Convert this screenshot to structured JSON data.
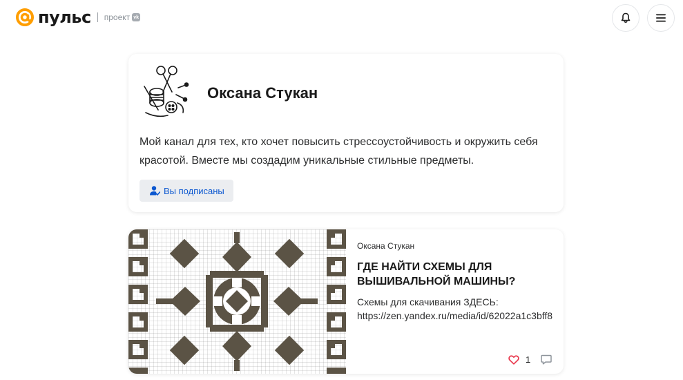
{
  "header": {
    "logo_text": "пульс",
    "project_label": "проект",
    "vk_badge": "vk",
    "brand_color": "#ff9e00",
    "icons": [
      "bell-icon",
      "menu-icon"
    ]
  },
  "channel": {
    "name": "Оксана Стукан",
    "description": "Мой канал для тех, кто хочет повысить стрессоустойчивость и окружить себя красотой. Вместе мы создадим уникальные стильные предметы.",
    "subscribe_label": "Вы подписаны",
    "accent_color": "#0b57d0"
  },
  "article": {
    "author": "Оксана Стукан",
    "title": "ГДЕ НАЙТИ СХЕМЫ ДЛЯ ВЫШИВАЛЬНОЙ МАШИНЫ?",
    "snippet_line1": "Схемы для скачивания ЗДЕСЬ:",
    "snippet_line2": "https://zen.yandex.ru/media/id/62022a1c3bff8",
    "likes": "1",
    "like_color": "#e8364b"
  }
}
